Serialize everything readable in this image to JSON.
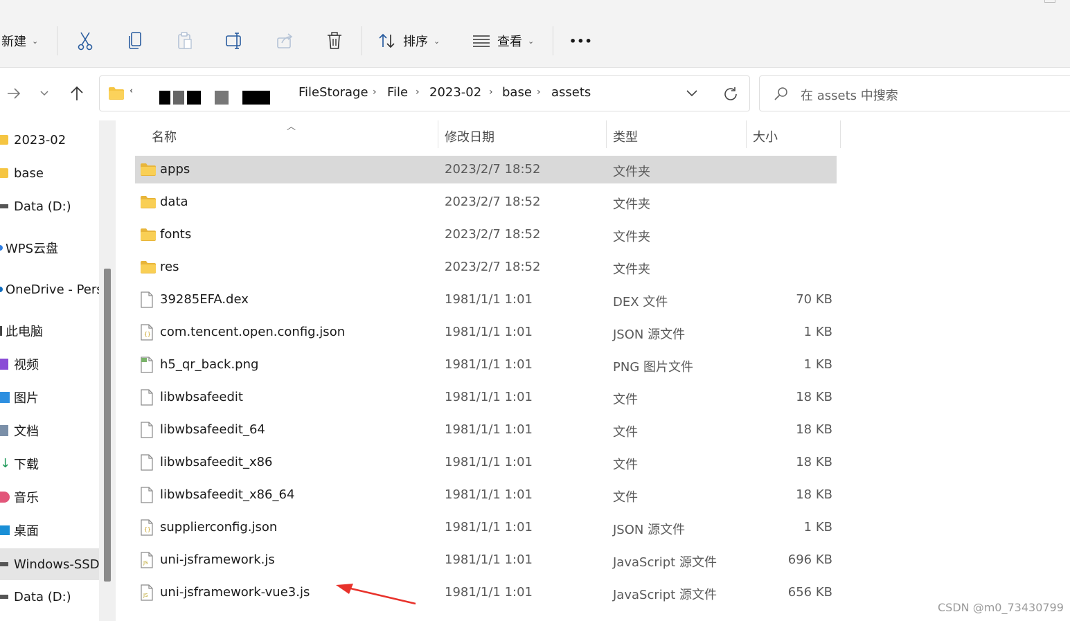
{
  "toolbar": {
    "new_label": "新建",
    "sort_label": "排序",
    "view_label": "查看",
    "more_label": "•••"
  },
  "address": {
    "crumbs": [
      "FileStorage",
      "File",
      "2023-02",
      "base",
      "assets"
    ]
  },
  "search": {
    "placeholder": "在 assets 中搜索"
  },
  "sidebar": {
    "items": [
      {
        "label": "2023-02",
        "icon": "folder-icon"
      },
      {
        "label": "base",
        "icon": "folder-icon"
      },
      {
        "label": "Data (D:)",
        "icon": "drive-icon"
      },
      {
        "label": "WPS云盘",
        "icon": "cloud-icon"
      },
      {
        "label": "OneDrive - Pers",
        "icon": "onedrive-icon"
      },
      {
        "label": "此电脑",
        "icon": "computer-icon"
      },
      {
        "label": "视频",
        "icon": "video-icon"
      },
      {
        "label": "图片",
        "icon": "pictures-icon"
      },
      {
        "label": "文档",
        "icon": "documents-icon"
      },
      {
        "label": "下载",
        "icon": "download-icon"
      },
      {
        "label": "音乐",
        "icon": "music-icon"
      },
      {
        "label": "桌面",
        "icon": "desktop-icon"
      },
      {
        "label": "Windows-SSD",
        "icon": "drive-icon"
      },
      {
        "label": "Data (D:)",
        "icon": "drive-icon"
      }
    ]
  },
  "columns": {
    "name": "名称",
    "date": "修改日期",
    "type": "类型",
    "size": "大小"
  },
  "files": [
    {
      "name": "apps",
      "date": "2023/2/7 18:52",
      "type": "文件夹",
      "size": "",
      "icon": "folder-icon"
    },
    {
      "name": "data",
      "date": "2023/2/7 18:52",
      "type": "文件夹",
      "size": "",
      "icon": "folder-icon"
    },
    {
      "name": "fonts",
      "date": "2023/2/7 18:52",
      "type": "文件夹",
      "size": "",
      "icon": "folder-icon"
    },
    {
      "name": "res",
      "date": "2023/2/7 18:52",
      "type": "文件夹",
      "size": "",
      "icon": "folder-icon"
    },
    {
      "name": "39285EFA.dex",
      "date": "1981/1/1 1:01",
      "type": "DEX 文件",
      "size": "70 KB",
      "icon": "file-icon"
    },
    {
      "name": "com.tencent.open.config.json",
      "date": "1981/1/1 1:01",
      "type": "JSON 源文件",
      "size": "1 KB",
      "icon": "json-file-icon"
    },
    {
      "name": "h5_qr_back.png",
      "date": "1981/1/1 1:01",
      "type": "PNG 图片文件",
      "size": "1 KB",
      "icon": "png-file-icon"
    },
    {
      "name": "libwbsafeedit",
      "date": "1981/1/1 1:01",
      "type": "文件",
      "size": "18 KB",
      "icon": "file-icon"
    },
    {
      "name": "libwbsafeedit_64",
      "date": "1981/1/1 1:01",
      "type": "文件",
      "size": "18 KB",
      "icon": "file-icon"
    },
    {
      "name": "libwbsafeedit_x86",
      "date": "1981/1/1 1:01",
      "type": "文件",
      "size": "18 KB",
      "icon": "file-icon"
    },
    {
      "name": "libwbsafeedit_x86_64",
      "date": "1981/1/1 1:01",
      "type": "文件",
      "size": "18 KB",
      "icon": "file-icon"
    },
    {
      "name": "supplierconfig.json",
      "date": "1981/1/1 1:01",
      "type": "JSON 源文件",
      "size": "1 KB",
      "icon": "json-file-icon"
    },
    {
      "name": "uni-jsframework.js",
      "date": "1981/1/1 1:01",
      "type": "JavaScript 源文件",
      "size": "696 KB",
      "icon": "js-file-icon"
    },
    {
      "name": "uni-jsframework-vue3.js",
      "date": "1981/1/1 1:01",
      "type": "JavaScript 源文件",
      "size": "656 KB",
      "icon": "js-file-icon"
    }
  ],
  "watermark": "CSDN @m0_73430799",
  "colors": {
    "folder": "#f5c542",
    "accent": "#0067c0",
    "annotation_arrow": "#e8322b"
  }
}
